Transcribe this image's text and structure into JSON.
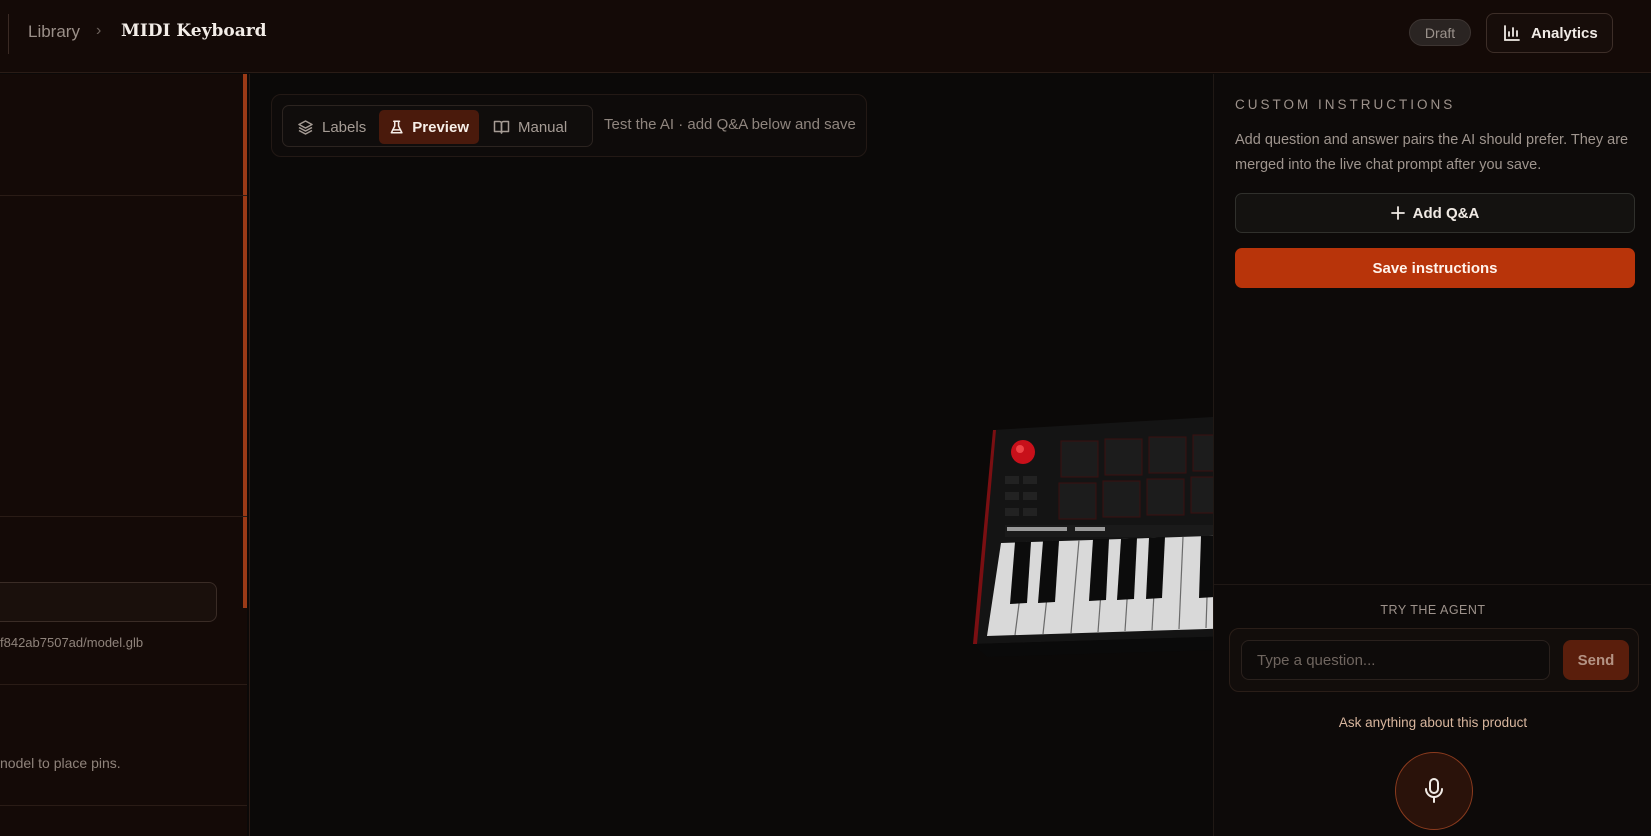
{
  "breadcrumb": {
    "library": "Library",
    "separator": "›",
    "current": "MIDI Keyboard"
  },
  "status": {
    "badge": "Draft"
  },
  "header": {
    "analytics_label": "Analytics"
  },
  "left_panel": {
    "model_path": "f842ab7507ad/model.glb",
    "pin_hint": "nodel to place pins."
  },
  "toolbar": {
    "tabs": [
      {
        "label": "Labels",
        "icon": "layers-icon"
      },
      {
        "label": "Preview",
        "icon": "flask-icon",
        "active": true
      },
      {
        "label": "Manual",
        "icon": "book-icon"
      }
    ],
    "hint": "Test the AI · add Q&A below and save"
  },
  "custom_instructions": {
    "title": "CUSTOM INSTRUCTIONS",
    "description": "Add question and answer pairs the AI should prefer. They are merged into the live chat prompt after you save.",
    "add_label": "Add Q&A",
    "save_label": "Save instructions"
  },
  "agent": {
    "title": "TRY THE AGENT",
    "placeholder": "Type a question...",
    "send_label": "Send",
    "ask_hint": "Ask anything about this product"
  },
  "colors": {
    "accent": "#b8340a",
    "active_tab": "#4a1a0c",
    "background": "#0b0908"
  }
}
